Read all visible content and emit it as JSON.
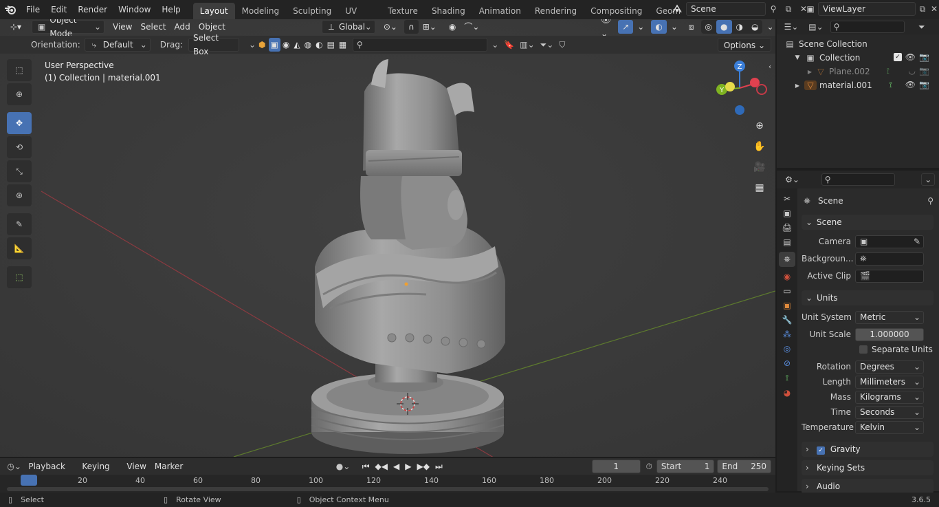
{
  "topbar": {
    "menus": [
      "File",
      "Edit",
      "Render",
      "Window",
      "Help"
    ],
    "workspaces": [
      "Layout",
      "Modeling",
      "Sculpting",
      "UV Editing",
      "Texture Paint",
      "Shading",
      "Animation",
      "Rendering",
      "Compositing",
      "Geometry Noc"
    ],
    "active_workspace": "Layout",
    "scene_name": "Scene",
    "view_layer": "ViewLayer"
  },
  "viewport": {
    "mode": "Object Mode",
    "menus": [
      "View",
      "Select",
      "Add",
      "Object"
    ],
    "transform_orientation": "Global",
    "orientation_label": "Orientation:",
    "orientation_value": "Default",
    "drag_label": "Drag:",
    "drag_value": "Select Box",
    "options_label": "Options",
    "overlay_title": "User Perspective",
    "overlay_subtitle": "(1) Collection | material.001",
    "gizmo_axes": {
      "x": "X",
      "y": "Y",
      "z": "Z"
    },
    "colors": {
      "x_axis": "#e0414f",
      "y_axis": "#7fb321",
      "z_axis": "#3b7fd9",
      "active_tool": "#4772b3"
    }
  },
  "outliner": {
    "root": "Scene Collection",
    "items": [
      {
        "name": "Collection",
        "level": 1
      },
      {
        "name": "Plane.002",
        "level": 2
      },
      {
        "name": "material.001",
        "level": 1
      }
    ]
  },
  "properties": {
    "context_title": "Scene",
    "scene_panel": {
      "title": "Scene",
      "camera_label": "Camera",
      "background_label": "Backgroun...",
      "active_clip_label": "Active Clip"
    },
    "units_panel": {
      "title": "Units",
      "unit_system_label": "Unit System",
      "unit_system": "Metric",
      "unit_scale_label": "Unit Scale",
      "unit_scale": "1.000000",
      "separate_units_label": "Separate Units",
      "rotation_label": "Rotation",
      "rotation": "Degrees",
      "length_label": "Length",
      "length": "Millimeters",
      "mass_label": "Mass",
      "mass": "Kilograms",
      "time_label": "Time",
      "time": "Seconds",
      "temperature_label": "Temperature",
      "temperature": "Kelvin"
    },
    "gravity_label": "Gravity",
    "keying_sets_label": "Keying Sets",
    "audio_label": "Audio"
  },
  "timeline": {
    "menus": [
      "Playback",
      "Keying",
      "View",
      "Marker"
    ],
    "current_frame": "1",
    "start_label": "Start",
    "start": "1",
    "end_label": "End",
    "end": "250",
    "ruler": [
      "1",
      "20",
      "40",
      "60",
      "80",
      "100",
      "120",
      "140",
      "160",
      "180",
      "200",
      "220",
      "240"
    ]
  },
  "statusbar": {
    "select": "Select",
    "rotate": "Rotate View",
    "context": "Object Context Menu",
    "version": "3.6.5"
  }
}
